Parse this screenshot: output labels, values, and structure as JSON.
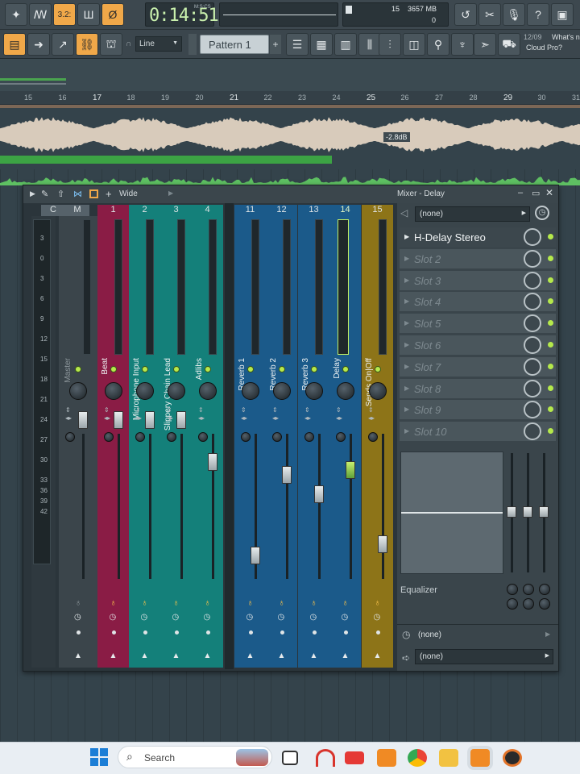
{
  "toolbar": {
    "time": "0:14:51",
    "time_label": "M:S:CS",
    "cpu_value": "15",
    "memory": "3657 MB",
    "voices": "0",
    "snap_mode": "Line",
    "pattern": "Pattern 1",
    "pattern_add": "+",
    "news_date": "12/09",
    "news_text": "What's n",
    "news_text2": "Cloud Pro?",
    "typing_mode_label": "3.2:"
  },
  "ruler": {
    "marks": [
      "15",
      "16",
      "17",
      "18",
      "19",
      "20",
      "21",
      "22",
      "23",
      "24",
      "25",
      "26",
      "27",
      "28",
      "29",
      "30",
      "31"
    ]
  },
  "playlist": {
    "clip_gain": "-2.8dB"
  },
  "mixer": {
    "title": "Mixer - Delay",
    "view_mode": "Wide",
    "channel_numbers": [
      "C",
      "M",
      "1",
      "2",
      "3",
      "4",
      "11",
      "12",
      "13",
      "14",
      "15"
    ],
    "scale": [
      "3",
      "0",
      "3",
      "6",
      "9",
      "12",
      "15",
      "18",
      "21",
      "24",
      "27",
      "30",
      "33",
      "36",
      "39",
      "42"
    ],
    "channels": [
      {
        "name": "Master",
        "color": "#3b454b"
      },
      {
        "name": "Beat",
        "color": "#8a1c45"
      },
      {
        "name": "Microphone Input",
        "color": "#14807a"
      },
      {
        "name": "Slippery Chain Lead",
        "color": "#14807a"
      },
      {
        "name": "Adlibs",
        "color": "#14807a"
      },
      {
        "name": "Reverb 1",
        "color": "#1b5a8a"
      },
      {
        "name": "Reverb 2",
        "color": "#1b5a8a"
      },
      {
        "name": "Reverb 3",
        "color": "#1b5a8a"
      },
      {
        "name": "Delay",
        "color": "#1b5a8a"
      },
      {
        "name": "Sends On|Off",
        "color": "#8d7418"
      }
    ],
    "preset": "(none)",
    "slots": [
      {
        "name": "H-Delay Stereo",
        "active": true
      },
      {
        "name": "Slot 2",
        "active": false
      },
      {
        "name": "Slot 3",
        "active": false
      },
      {
        "name": "Slot 4",
        "active": false
      },
      {
        "name": "Slot 5",
        "active": false
      },
      {
        "name": "Slot 6",
        "active": false
      },
      {
        "name": "Slot 7",
        "active": false
      },
      {
        "name": "Slot 8",
        "active": false
      },
      {
        "name": "Slot 9",
        "active": false
      },
      {
        "name": "Slot 10",
        "active": false
      }
    ],
    "equalizer_label": "Equalizer",
    "in_routing": "(none)",
    "out_routing": "(none)"
  },
  "taskbar": {
    "search_placeholder": "Search"
  },
  "colors": {
    "accent_orange": "#f0a849",
    "led_green": "#b5e94b",
    "background": "#34434b"
  }
}
